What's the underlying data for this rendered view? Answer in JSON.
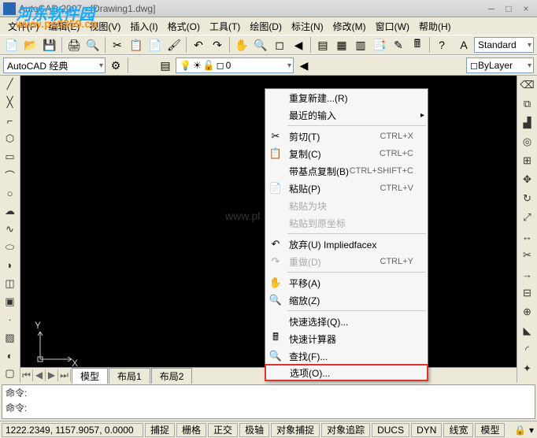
{
  "title": "AutoCAD 2007 - [Drawing1.dwg]",
  "watermark_main": "河东软件园",
  "watermark_url": "www.pc0359.cn",
  "watermark_center": "www.pl",
  "menu": {
    "file": "文件(F)",
    "edit": "编辑(E)",
    "view": "视图(V)",
    "insert": "插入(I)",
    "format": "格式(O)",
    "tools": "工具(T)",
    "draw": "绘图(D)",
    "dim": "标注(N)",
    "modify": "修改(M)",
    "window": "窗口(W)",
    "help": "帮助(H)"
  },
  "toolbar2": {
    "workspace": "AutoCAD 经典",
    "layer_current": "0",
    "style_label": "Standard",
    "bylayer": "ByLayer"
  },
  "context_menu": {
    "repeat_new": "重复新建...(R)",
    "recent_input": "最近的输入",
    "cut": "剪切(T)",
    "cut_key": "CTRL+X",
    "copy": "复制(C)",
    "copy_key": "CTRL+C",
    "copy_base": "带基点复制(B)",
    "copy_base_key": "CTRL+SHIFT+C",
    "paste": "粘贴(P)",
    "paste_key": "CTRL+V",
    "paste_block": "粘贴为块",
    "paste_coord": "粘贴到原坐标",
    "undo": "放弃(U) Impliedfacex",
    "redo": "重做(D)",
    "redo_key": "CTRL+Y",
    "pan": "平移(A)",
    "zoom": "缩放(Z)",
    "qselect": "快速选择(Q)...",
    "quickcalc": "快速计算器",
    "find": "查找(F)...",
    "options": "选项(O)..."
  },
  "tabs": {
    "model": "模型",
    "layout1": "布局1",
    "layout2": "布局2"
  },
  "cmd": {
    "line1": "命令:",
    "line2": "命令:"
  },
  "status": {
    "coords": "1222.2349, 1157.9057, 0.0000",
    "snap": "捕捉",
    "grid": "栅格",
    "ortho": "正交",
    "polar": "极轴",
    "osnap": "对象捕捉",
    "otrack": "对象追踪",
    "ducs": "DUCS",
    "dyn": "DYN",
    "lwt": "线宽",
    "model": "模型"
  },
  "ucs": {
    "x": "X",
    "y": "Y"
  }
}
